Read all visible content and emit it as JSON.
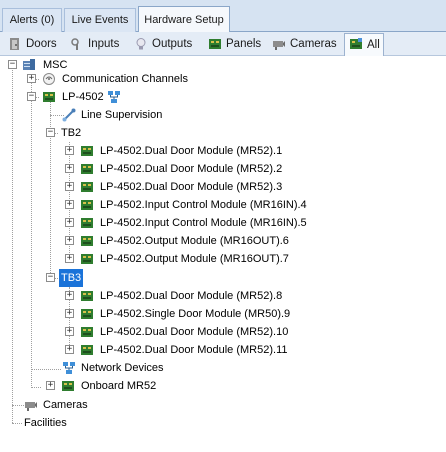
{
  "top_tabs": [
    {
      "label": "Alerts (0)"
    },
    {
      "label": "Live Events"
    },
    {
      "label": "Hardware Setup"
    }
  ],
  "sub_tabs": [
    {
      "label": "Doors",
      "icon": "door-icon"
    },
    {
      "label": "Inputs",
      "icon": "input-icon"
    },
    {
      "label": "Outputs",
      "icon": "bulb-icon"
    },
    {
      "label": "Panels",
      "icon": "panel-icon"
    },
    {
      "label": "Cameras",
      "icon": "camera-icon"
    },
    {
      "label": "All",
      "icon": "all-icon"
    }
  ],
  "tree": {
    "msc": "MSC",
    "comm_channels": "Communication Channels",
    "lp4502": "LP-4502",
    "line_supervision": "Line Supervision",
    "tb2": "TB2",
    "tb2_items": [
      "LP-4502.Dual Door Module (MR52).1",
      "LP-4502.Dual Door Module (MR52).2",
      "LP-4502.Dual Door Module (MR52).3",
      "LP-4502.Input Control Module (MR16IN).4",
      "LP-4502.Input Control Module (MR16IN).5",
      "LP-4502.Output Module (MR16OUT).6",
      "LP-4502.Output Module (MR16OUT).7"
    ],
    "tb3": "TB3",
    "tb3_items": [
      "LP-4502.Dual Door Module (MR52).8",
      "LP-4502.Single Door Module (MR50).9",
      "LP-4502.Dual Door Module (MR52).10",
      "LP-4502.Dual Door Module (MR52).11"
    ],
    "network_devices": "Network Devices",
    "onboard": "Onboard MR52",
    "cameras": "Cameras",
    "facilities": "Facilities"
  },
  "colors": {
    "selection": "#1a73d9",
    "tab_bg": "#d6e3f2"
  }
}
